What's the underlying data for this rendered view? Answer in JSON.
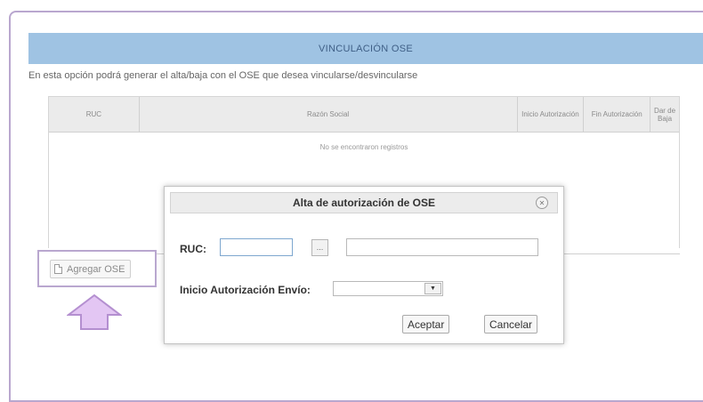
{
  "panel": {
    "title": "VINCULACIÓN OSE",
    "intro": "En esta opción podrá generar el alta/baja con el OSE que desea vincularse/desvincularse"
  },
  "grid": {
    "columns": [
      "RUC",
      "Razón Social",
      "Inicio Autorización",
      "Fin Autorización",
      "Dar de Baja"
    ],
    "empty_message": "No se encontraron registros"
  },
  "add_button": {
    "label": "Agregar OSE",
    "icon": "document-icon"
  },
  "highlight_color": "#b9a7cf",
  "arrow_color": "#e3c6f3",
  "dialog": {
    "title": "Alta de autorización de OSE",
    "close_icon": "close-circle-icon",
    "ruc_label": "RUC:",
    "ruc_value": "",
    "search_label": "...",
    "name_value": "",
    "inicio_label": "Inicio Autorización Envío:",
    "inicio_value": "",
    "accept_label": "Aceptar",
    "cancel_label": "Cancelar"
  }
}
